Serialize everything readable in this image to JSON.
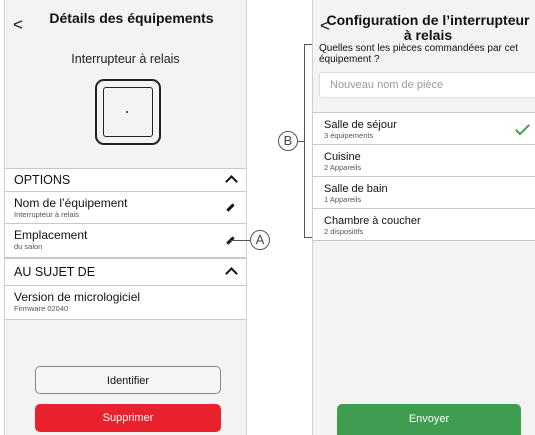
{
  "left_screen": {
    "back_icon": "chevron-left-icon",
    "title": "Détails des équipements",
    "device_name": "Interrupteur à relais",
    "options_header": "OPTIONS",
    "equipment_name_label": "Nom de l’équipement",
    "equipment_name_value": "Interrupteur à relais",
    "location_label": "Emplacement",
    "location_value": "du salon",
    "about_header": "AU SUJET DE",
    "firmware_label": "Version de micrologiciel",
    "firmware_value": "Firmware 02040",
    "identify_button": "Identifier",
    "delete_button": "Supprimer",
    "delete_color": "#e8212c"
  },
  "right_screen": {
    "back_icon": "chevron-left-icon",
    "title": "Configuration de l’interrupteur à relais",
    "question": "Quelles sont les pièces commandées par cet équipement ?",
    "new_room_placeholder": "Nouveau nom de pièce",
    "rooms": [
      {
        "name": "Salle de séjour",
        "count": "3 équipements",
        "selected": true
      },
      {
        "name": "Cuisine",
        "count": "2 Appareils",
        "selected": false
      },
      {
        "name": "Salle de bain",
        "count": "1 Appareils",
        "selected": false
      },
      {
        "name": "Chambre à coucher",
        "count": "2 dispositifs",
        "selected": false
      }
    ],
    "send_button": "Envoyer",
    "send_color": "#3e9d4e",
    "check_color": "#3aa54a"
  },
  "callouts": {
    "a": "A",
    "b": "B"
  }
}
